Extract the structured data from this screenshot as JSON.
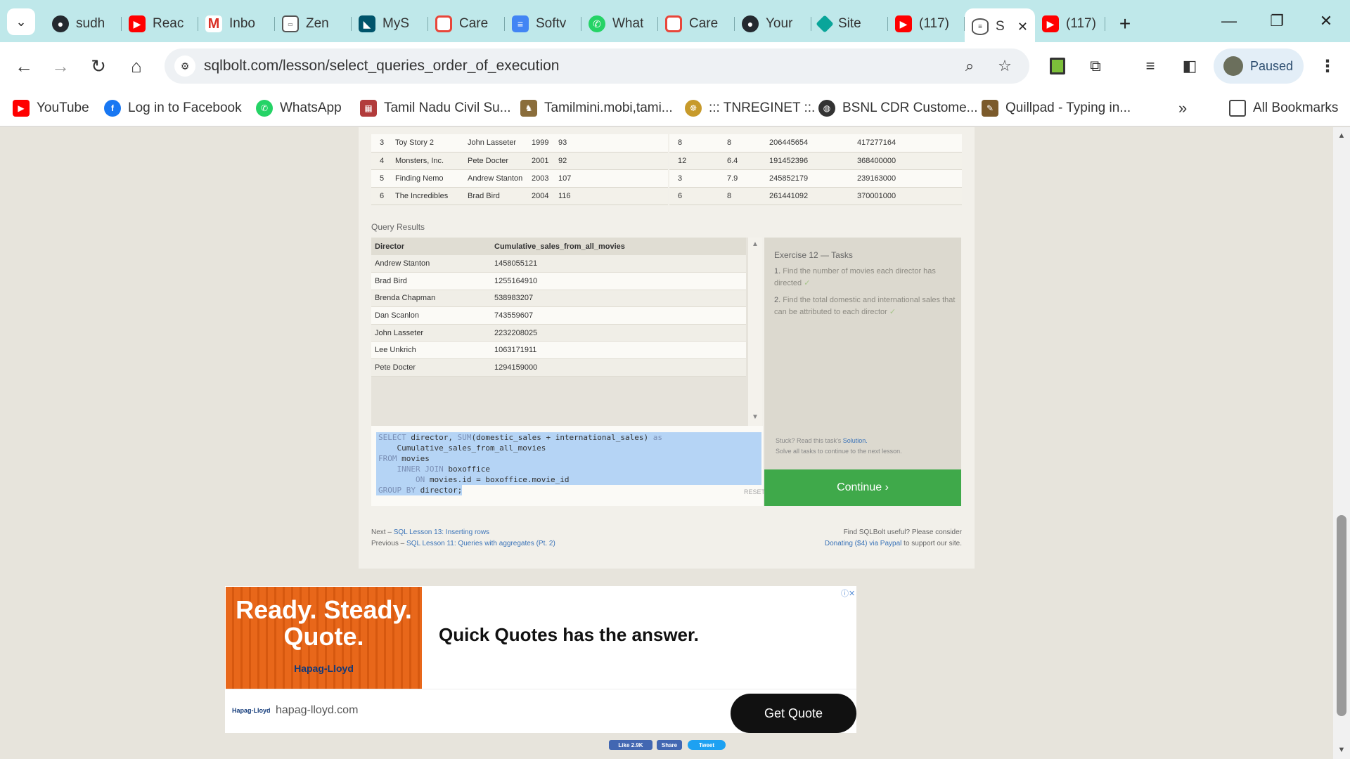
{
  "browser": {
    "tabs": [
      {
        "label": "sudh",
        "icon": "github-icon",
        "color": "#24292f"
      },
      {
        "label": "Reac",
        "icon": "youtube-icon",
        "color": "#ff0000"
      },
      {
        "label": "Inbo",
        "icon": "gmail-icon",
        "color": "#d93025"
      },
      {
        "label": "Zen",
        "icon": "classroom-icon",
        "color": "#555555"
      },
      {
        "label": "MyS",
        "icon": "mysql-icon",
        "color": "#00546b"
      },
      {
        "label": "Care",
        "icon": "careers-icon",
        "color": "#e8463a"
      },
      {
        "label": "Softv",
        "icon": "document-icon",
        "color": "#4285f4"
      },
      {
        "label": "What",
        "icon": "whatsapp-icon",
        "color": "#25d366"
      },
      {
        "label": "Care",
        "icon": "careers-icon",
        "color": "#e8463a"
      },
      {
        "label": "Your",
        "icon": "github-icon",
        "color": "#24292f"
      },
      {
        "label": "Site",
        "icon": "diamond-icon",
        "color": "#0aa59a"
      },
      {
        "label": "(117)",
        "icon": "youtube-icon",
        "color": "#ff0000"
      }
    ],
    "active_tab": {
      "label": "S",
      "icon": "database-icon",
      "close": "✕"
    },
    "last_tab": {
      "label": "(117)",
      "icon": "youtube-icon"
    },
    "new_tab": "+",
    "url": "sqlbolt.com/lesson/select_queries_order_of_execution",
    "profile_status": "Paused"
  },
  "bookmarks": [
    {
      "label": "YouTube",
      "icon": "youtube-icon",
      "color": "#ff0000"
    },
    {
      "label": "Log in to Facebook",
      "icon": "facebook-icon",
      "color": "#1877f2"
    },
    {
      "label": "WhatsApp",
      "icon": "whatsapp-icon",
      "color": "#25d366"
    },
    {
      "label": "Tamil Nadu Civil Su...",
      "icon": "tn-civil-icon",
      "color": "#b23b3b"
    },
    {
      "label": "Tamilmini.mobi,tami...",
      "icon": "tamilmini-icon",
      "color": "#8a6d3b"
    },
    {
      "label": "::: TNREGINET ::.",
      "icon": "tn-emblem-icon",
      "color": "#c79a2b"
    },
    {
      "label": "BSNL CDR Custome...",
      "icon": "globe-icon",
      "color": "#333333"
    },
    {
      "label": "Quillpad - Typing in...",
      "icon": "quillpad-icon",
      "color": "#7b5a2b"
    }
  ],
  "bookmarks_overflow": "»",
  "all_bookmarks": "All Bookmarks",
  "top_tables": {
    "left_rows": [
      [
        "3",
        "Toy Story 2",
        "John Lasseter",
        "1999",
        "93"
      ],
      [
        "4",
        "Monsters, Inc.",
        "Pete Docter",
        "2001",
        "92"
      ],
      [
        "5",
        "Finding Nemo",
        "Andrew Stanton",
        "2003",
        "107"
      ],
      [
        "6",
        "The Incredibles",
        "Brad Bird",
        "2004",
        "116"
      ]
    ],
    "right_rows": [
      [
        "8",
        "8",
        "206445654",
        "417277164"
      ],
      [
        "12",
        "6.4",
        "191452396",
        "368400000"
      ],
      [
        "3",
        "7.9",
        "245852179",
        "239163000"
      ],
      [
        "6",
        "8",
        "261441092",
        "370001000"
      ]
    ]
  },
  "query_results": {
    "label": "Query Results",
    "columns": [
      "Director",
      "Cumulative_sales_from_all_movies"
    ],
    "rows": [
      [
        "Andrew Stanton",
        "1458055121"
      ],
      [
        "Brad Bird",
        "1255164910"
      ],
      [
        "Brenda Chapman",
        "538983207"
      ],
      [
        "Dan Scanlon",
        "743559607"
      ],
      [
        "John Lasseter",
        "2232208025"
      ],
      [
        "Lee Unkrich",
        "1063171911"
      ],
      [
        "Pete Docter",
        "1294159000"
      ]
    ]
  },
  "editor": {
    "reset": "RESET"
  },
  "tasks": {
    "title": "Exercise 12 — Tasks",
    "items": [
      {
        "num": "1.",
        "text": "Find the number of movies each director has directed",
        "check": "✓"
      },
      {
        "num": "2.",
        "text": "Find the total domestic and international sales that can be attributed to each director",
        "check": "✓"
      }
    ],
    "stuck_prefix": "Stuck? Read this task's",
    "stuck_link": "Solution.",
    "stuck_line2": "Solve all tasks to continue to the next lesson.",
    "continue": "Continue ›"
  },
  "footer": {
    "next_prefix": "Next –",
    "next_link": "SQL Lesson 13: Inserting rows",
    "prev_prefix": "Previous –",
    "prev_link": "SQL Lesson 11: Queries with aggregates (Pt. 2)",
    "useful": "Find SQLBolt useful? Please consider",
    "donate_link": "Donating ($4) via Paypal",
    "donate_suffix": "to support our site."
  },
  "ad": {
    "headline": "Ready. Steady. Quote.",
    "brand": "Hapag-Lloyd",
    "title": "Quick Quotes has the answer.",
    "domain": "hapag-lloyd.com",
    "cta": "Get Quote",
    "choices": "ⓘ✕"
  },
  "social": {
    "like": "Like 2.9K",
    "share": "Share",
    "tweet": "Tweet"
  }
}
